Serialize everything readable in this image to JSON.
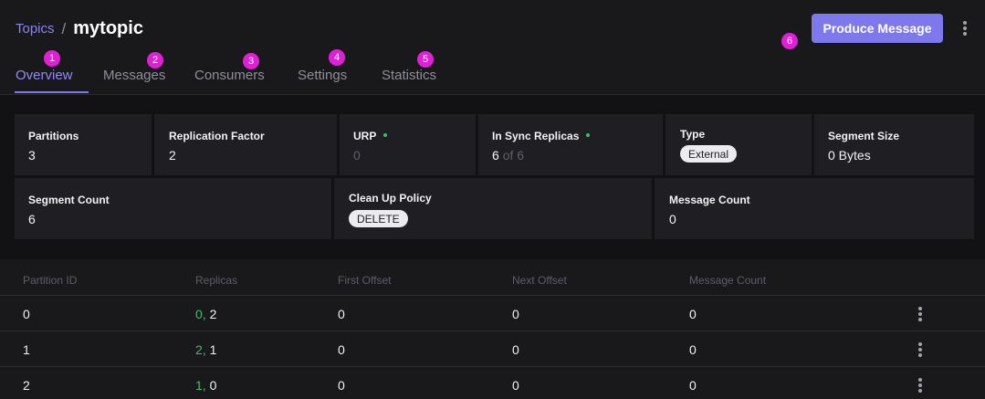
{
  "breadcrumb": {
    "parent": "Topics",
    "separator": "/",
    "title": "mytopic"
  },
  "actions": {
    "produce_label": "Produce Message",
    "produce_color": "#7d78eb"
  },
  "tabs": [
    {
      "label": "Overview",
      "badge": "1",
      "active": true
    },
    {
      "label": "Messages",
      "badge": "2"
    },
    {
      "label": "Consumers",
      "badge": "3"
    },
    {
      "label": "Settings",
      "badge": "4"
    },
    {
      "label": "Statistics",
      "badge": "5"
    }
  ],
  "produce_badge": "6",
  "stats": {
    "partitions": {
      "label": "Partitions",
      "value": "3"
    },
    "replication_factor": {
      "label": "Replication Factor",
      "value": "2"
    },
    "urp": {
      "label": "URP",
      "value": "0"
    },
    "in_sync": {
      "label": "In Sync Replicas",
      "value": "6",
      "of_text": "of 6"
    },
    "type": {
      "label": "Type",
      "value": "External"
    },
    "segment_size": {
      "label": "Segment Size",
      "value": "0 Bytes"
    },
    "segment_count": {
      "label": "Segment Count",
      "value": "6"
    },
    "cleanup_policy": {
      "label": "Clean Up Policy",
      "value": "DELETE"
    },
    "message_count": {
      "label": "Message Count",
      "value": "0"
    }
  },
  "table": {
    "columns": [
      "Partition ID",
      "Replicas",
      "First Offset",
      "Next Offset",
      "Message Count"
    ],
    "rows": [
      {
        "partition": "0",
        "replica_leader": "0,",
        "replica_other": "2",
        "first_offset": "0",
        "next_offset": "0",
        "message_count": "0"
      },
      {
        "partition": "1",
        "replica_leader": "2,",
        "replica_other": "1",
        "first_offset": "0",
        "next_offset": "0",
        "message_count": "0"
      },
      {
        "partition": "2",
        "replica_leader": "1,",
        "replica_other": "0",
        "first_offset": "0",
        "next_offset": "0",
        "message_count": "0"
      }
    ]
  },
  "colors": {
    "accent": "#7d78eb",
    "in_sync": "#33c36a",
    "badge": "#e020d6"
  }
}
